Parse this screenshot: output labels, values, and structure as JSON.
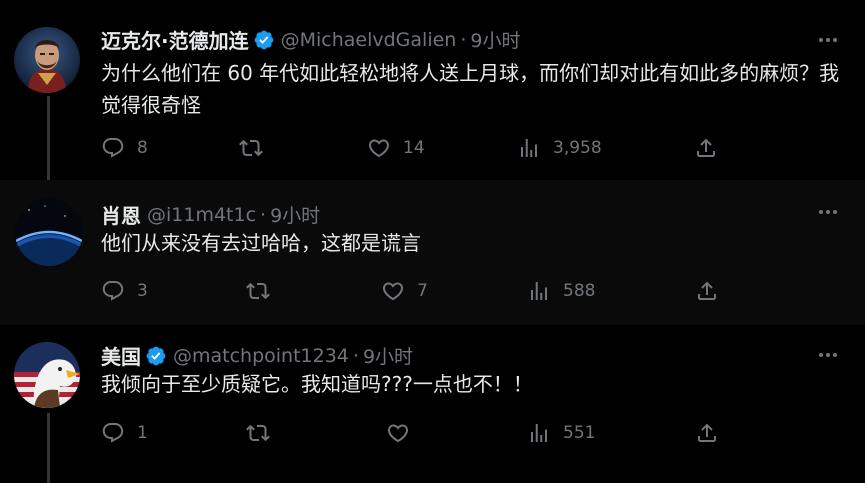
{
  "colors": {
    "background": "#000000",
    "text": "#e7e9ea",
    "muted": "#71767b",
    "verified": "#1d9bf0",
    "divider": "#333639"
  },
  "tweets": [
    {
      "name": "迈克尔·范德加连",
      "verified": true,
      "handle": "@MichaelvdGalien",
      "dot": "·",
      "time": "9小时",
      "text": "为什么他们在 60 年代如此轻松地将人送上月球，而你们却对此有如此多的麻烦？我觉得很奇怪",
      "replies": "8",
      "retweets": "",
      "likes": "14",
      "views": "3,958",
      "icons": [
        "reply-icon",
        "retweet-icon",
        "like-icon",
        "views-icon",
        "share-icon",
        "more-icon"
      ]
    },
    {
      "name": "肖恩",
      "verified": false,
      "handle": "@i11m4t1c",
      "dot": "·",
      "time": "9小时",
      "text": "他们从来没有去过哈哈，这都是谎言",
      "replies": "3",
      "retweets": "",
      "likes": "7",
      "views": "588"
    },
    {
      "name": "美国",
      "verified": true,
      "handle": "@matchpoint1234",
      "dot": "·",
      "time": "9小时",
      "text": "我倾向于至少质疑它。我知道吗???一点也不！！",
      "replies": "1",
      "retweets": "",
      "likes": "",
      "views": "551"
    }
  ]
}
